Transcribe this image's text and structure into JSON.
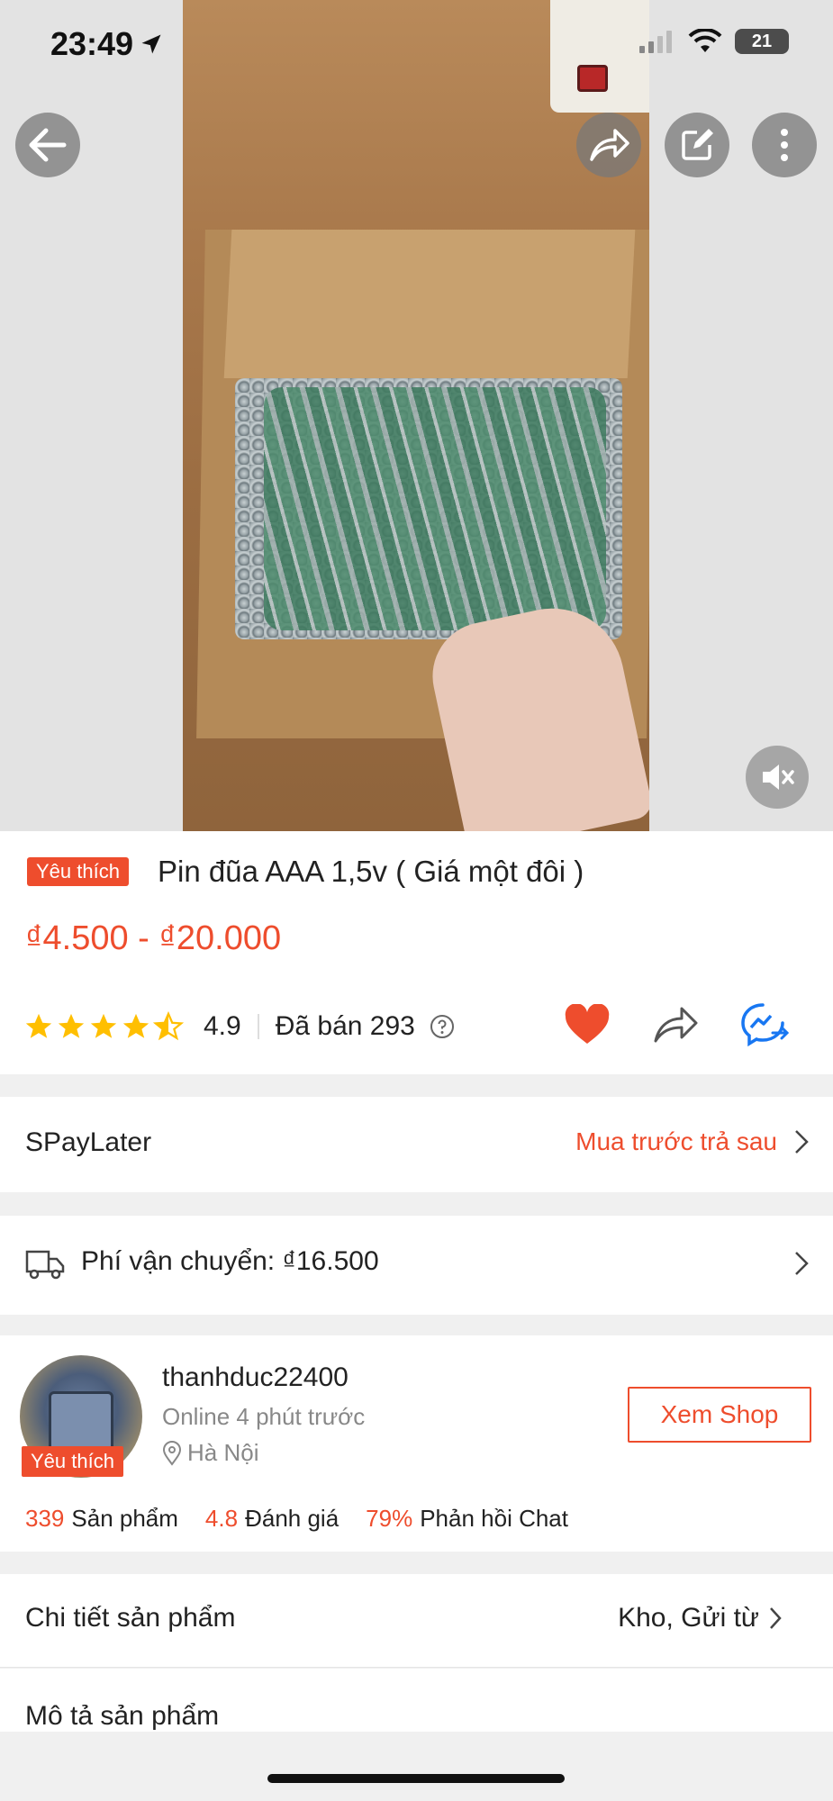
{
  "status_bar": {
    "time": "23:49",
    "battery": "21"
  },
  "product": {
    "favorite_tag": "Yêu thích",
    "title": "Pin đũa AAA 1,5v ( Giá một đôi )",
    "price_range": "₫4.500 - ₫20.000",
    "rating": "4.9",
    "stars": 4.5,
    "sold": "Đã bán 293"
  },
  "spaylater": {
    "label": "SPayLater",
    "action": "Mua trước trả sau"
  },
  "shipping": {
    "label": "Phí vận chuyển: ₫16.500"
  },
  "shop": {
    "favorite_tag": "Yêu thích",
    "name": "thanhduc22400",
    "online": "Online 4 phút trước",
    "location": "Hà Nội",
    "view_button": "Xem Shop",
    "stats": [
      {
        "value": "339",
        "label": "Sản phẩm"
      },
      {
        "value": "4.8",
        "label": "Đánh giá"
      },
      {
        "value": "79%",
        "label": "Phản hồi Chat"
      }
    ]
  },
  "details": {
    "label": "Chi tiết sản phẩm",
    "right": "Kho, Gửi từ"
  },
  "description": {
    "label": "Mô tả sản phẩm"
  },
  "colors": {
    "accent": "#ee4d2d",
    "heart": "#ee4d2d",
    "messenger": "#1877f2"
  },
  "icons": [
    "back-arrow-icon",
    "share-icon",
    "edit-icon",
    "more-icon",
    "mute-icon",
    "star-icon",
    "question-icon",
    "heart-icon",
    "messenger-icon",
    "chevron-right-icon",
    "truck-icon",
    "location-pin-icon"
  ]
}
